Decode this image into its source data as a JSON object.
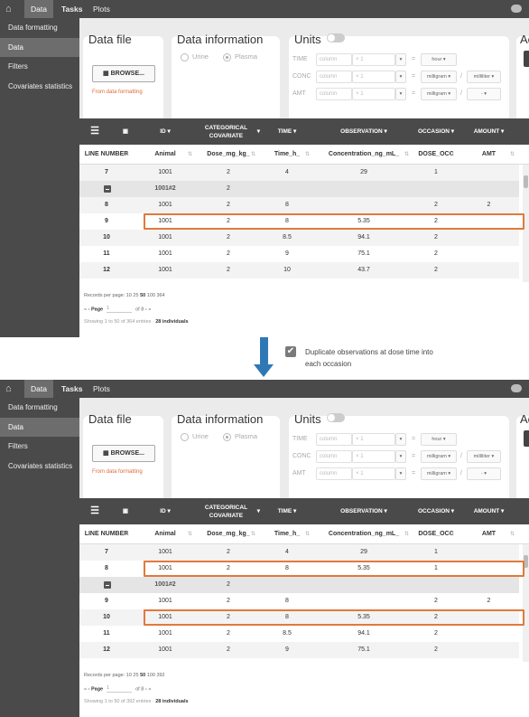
{
  "nav": {
    "tabs": [
      "Data",
      "Tasks",
      "Plots"
    ]
  },
  "sidebar": {
    "items": [
      "Data formatting",
      "Data",
      "Filters",
      "Covariates statistics"
    ]
  },
  "cards": {
    "data_file": {
      "title": "Data file",
      "browse_label": "BROWSE...",
      "link": "From data formatting"
    },
    "data_info": {
      "title": "Data information",
      "urine": "Urine",
      "plasma": "Plasma"
    },
    "units": {
      "title": "Units",
      "rows": [
        {
          "label": "TIME",
          "col_placeholder": "column",
          "mult": "×",
          "val_placeholder": "1",
          "unit1": "hour",
          "slash": "",
          "unit2": ""
        },
        {
          "label": "CONC",
          "col_placeholder": "column",
          "mult": "×",
          "val_placeholder": "1",
          "unit1": "milligram",
          "slash": "/",
          "unit2": "milliliter"
        },
        {
          "label": "AMT",
          "col_placeholder": "column",
          "mult": "×",
          "val_placeholder": "1",
          "unit1": "milligram",
          "slash": "/",
          "unit2": "-"
        }
      ],
      "eq": "="
    },
    "actions": {
      "title": "Ac"
    }
  },
  "table": {
    "headers": [
      "ID",
      "CATEGORICAL COVARIATE",
      "TIME",
      "OBSERVATION",
      "OCCASION",
      "AMOUNT"
    ],
    "columns": [
      "LINE NUMBER",
      "Animal",
      "Dose_mg_kg_",
      "Time_h_",
      "Concentration_ng_mL_",
      "DOSE_OCC",
      "AMT"
    ]
  },
  "before": {
    "rows": [
      {
        "type": "data",
        "line": "7",
        "animal": "1001",
        "dose": "2",
        "time": "4",
        "conc": "29",
        "occ": "1",
        "amt": ""
      },
      {
        "type": "group",
        "group": "1001#2",
        "dose": "2"
      },
      {
        "type": "data",
        "line": "8",
        "animal": "1001",
        "dose": "2",
        "time": "8",
        "conc": "",
        "occ": "2",
        "amt": "2"
      },
      {
        "type": "data",
        "line": "9",
        "animal": "1001",
        "dose": "2",
        "time": "8",
        "conc": "5.35",
        "occ": "2",
        "amt": ""
      },
      {
        "type": "data",
        "line": "10",
        "animal": "1001",
        "dose": "2",
        "time": "8.5",
        "conc": "94.1",
        "occ": "2",
        "amt": ""
      },
      {
        "type": "data",
        "line": "11",
        "animal": "1001",
        "dose": "2",
        "time": "9",
        "conc": "75.1",
        "occ": "2",
        "amt": ""
      },
      {
        "type": "data",
        "line": "12",
        "animal": "1001",
        "dose": "2",
        "time": "10",
        "conc": "43.7",
        "occ": "2",
        "amt": ""
      }
    ],
    "records_label": "Records per page:",
    "records_options": "10 25",
    "records_selected": "50",
    "records_more": "100 364",
    "page_label": "Page",
    "page_value": "1",
    "page_of": "of 8",
    "showing": "Showing 1 to 50 of 364 entries ·",
    "individuals": "28 individuals"
  },
  "option": {
    "checked": "✔",
    "label": "Duplicate observations at dose time into each occasion"
  },
  "after": {
    "rows": [
      {
        "type": "data",
        "line": "7",
        "animal": "1001",
        "dose": "2",
        "time": "4",
        "conc": "29",
        "occ": "1",
        "amt": ""
      },
      {
        "type": "data",
        "line": "8",
        "animal": "1001",
        "dose": "2",
        "time": "8",
        "conc": "5.35",
        "occ": "1",
        "amt": ""
      },
      {
        "type": "group",
        "group": "1001#2",
        "dose": "2"
      },
      {
        "type": "data",
        "line": "9",
        "animal": "1001",
        "dose": "2",
        "time": "8",
        "conc": "",
        "occ": "2",
        "amt": "2"
      },
      {
        "type": "data",
        "line": "10",
        "animal": "1001",
        "dose": "2",
        "time": "8",
        "conc": "5.35",
        "occ": "2",
        "amt": ""
      },
      {
        "type": "data",
        "line": "11",
        "animal": "1001",
        "dose": "2",
        "time": "8.5",
        "conc": "94.1",
        "occ": "2",
        "amt": ""
      },
      {
        "type": "data",
        "line": "12",
        "animal": "1001",
        "dose": "2",
        "time": "9",
        "conc": "75.1",
        "occ": "2",
        "amt": ""
      }
    ],
    "records_label": "Records per page:",
    "records_options": "10 25",
    "records_selected": "50",
    "records_more": "100 392",
    "page_label": "Page",
    "page_value": "1",
    "page_of": "of 8",
    "showing": "Showing 1 to 50 of 392 entries ·",
    "individuals": "28 individuals"
  },
  "colors": {
    "highlight": "#e07a3c",
    "arrow": "#2f78b6",
    "link": "#e06a3a"
  }
}
